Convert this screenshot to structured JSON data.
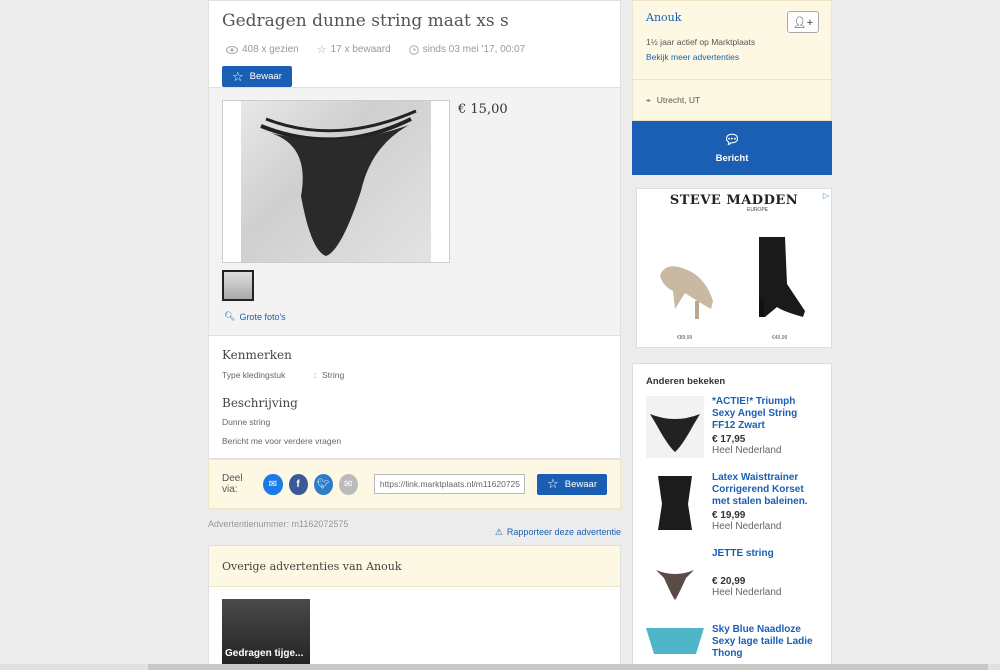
{
  "listing": {
    "title": "Gedragen dunne string maat xs s",
    "views": "408 x gezien",
    "saved": "17 x bewaard",
    "since": "sinds 03 mei '17, 00:07",
    "save_label": "Bewaar",
    "price": "€ 15,00",
    "big_photos": "Grote foto's"
  },
  "details": {
    "features_heading": "Kenmerken",
    "feature_key": "Type kledingstuk",
    "feature_sep": ":",
    "feature_value": "String",
    "description_heading": "Beschrijving",
    "description_lines": [
      "Dunne string",
      "Bericht me voor verdere vragen"
    ]
  },
  "share": {
    "label": "Deel via:",
    "link": "https://link.marktplaats.nl/m11620725",
    "save_label": "Bewaar"
  },
  "meta": {
    "ad_number": "Advertentienummer: m1162072575",
    "report": "Rapporteer deze advertentie"
  },
  "other_ads": {
    "heading": "Overige advertenties van Anouk",
    "item_caption": "Gedragen tijge..."
  },
  "seller": {
    "name": "Anouk",
    "active": "1½ jaar actief op Marktplaats",
    "more": "Bekijk meer advertenties",
    "location": "Utrecht, UT",
    "message_label": "Bericht"
  },
  "banner": {
    "brand": "STEVE MADDEN",
    "sub": "EUROPE",
    "price1": "€89,99",
    "price2": "€49,99"
  },
  "others_viewed": {
    "heading": "Anderen bekeken",
    "items": [
      {
        "title": "*ACTIE!* Triumph Sexy Angel String FF12 Zwart",
        "price": "€ 17,95",
        "location": "Heel Nederland"
      },
      {
        "title": "Latex Waisttrainer Corrigerend Korset met stalen baleinen.",
        "price": "€ 19,99",
        "location": "Heel Nederland"
      },
      {
        "title": "JETTE string",
        "price": "€ 20,99",
        "location": "Heel Nederland"
      },
      {
        "title": "Sky Blue Naadloze Sexy lage taille Ladie Thong",
        "price": "",
        "location": ""
      }
    ]
  }
}
